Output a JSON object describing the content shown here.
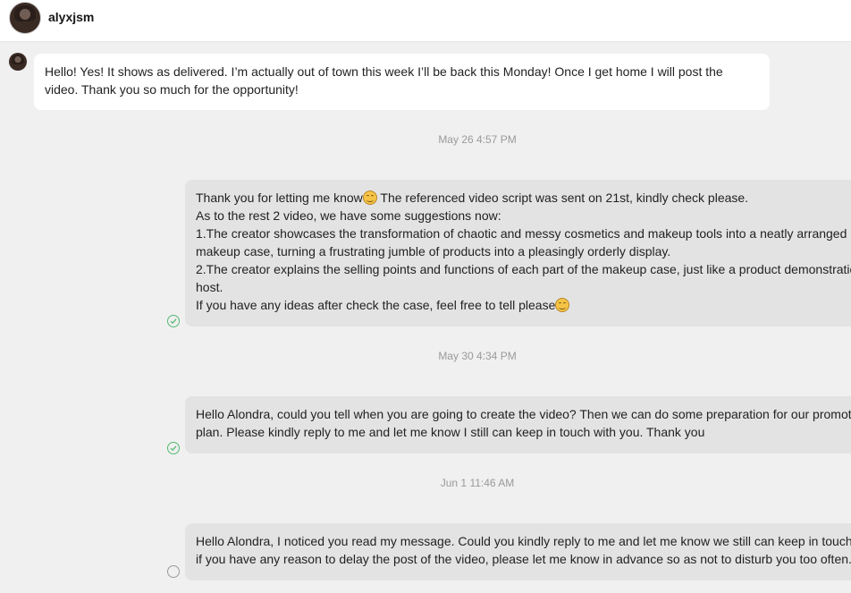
{
  "header": {
    "username": "alyxjsm"
  },
  "messages": {
    "incoming_1": [
      "Hello! Yes! It shows as delivered. I’m actually out of town this week I’ll be back this Monday! Once I get home I will post the",
      "video. Thank you so much for the opportunity!"
    ],
    "stamp_1": "May 26 4:57 PM",
    "outgoing_1": {
      "line_1_before_emoji": "Thank you for letting me know",
      "line_1_after_emoji": " The referenced video script was sent on 21st, kindly check please.",
      "lines": [
        "As to the rest 2 video, we have some suggestions now:",
        "1.The creator showcases the transformation of chaotic and messy cosmetics and makeup tools into a neatly arranged",
        "makeup case, turning a frustrating jumble of products into a pleasingly orderly display.",
        "2.The creator explains the selling points and functions of each part of the makeup case, just like a product demonstration",
        "host."
      ],
      "last_line_before_emoji": "If you have any ideas after check the case, feel free to tell please"
    },
    "stamp_2": "May 30 4:34 PM",
    "outgoing_2": [
      "Hello Alondra, could you tell when you are going to create the video? Then we can do some preparation for our promotion",
      "plan.  Please kindly reply to me and let me know I still can keep in touch with you. Thank you"
    ],
    "stamp_3": "Jun 1 11:46 AM",
    "outgoing_3": [
      "Hello Alondra, I noticed you read my message. Could you kindly reply to me and let me know we still can keep in touch? And",
      "if you have any reason to delay the post of the video, please let me know in advance so as not to disturb you too often."
    ]
  },
  "colors": {
    "background": "#f0f0f0",
    "incoming_bubble": "#ffffff",
    "outgoing_bubble": "#e3e3e3",
    "read_status": "#55b874",
    "sent_status": "#9a9a9a"
  }
}
